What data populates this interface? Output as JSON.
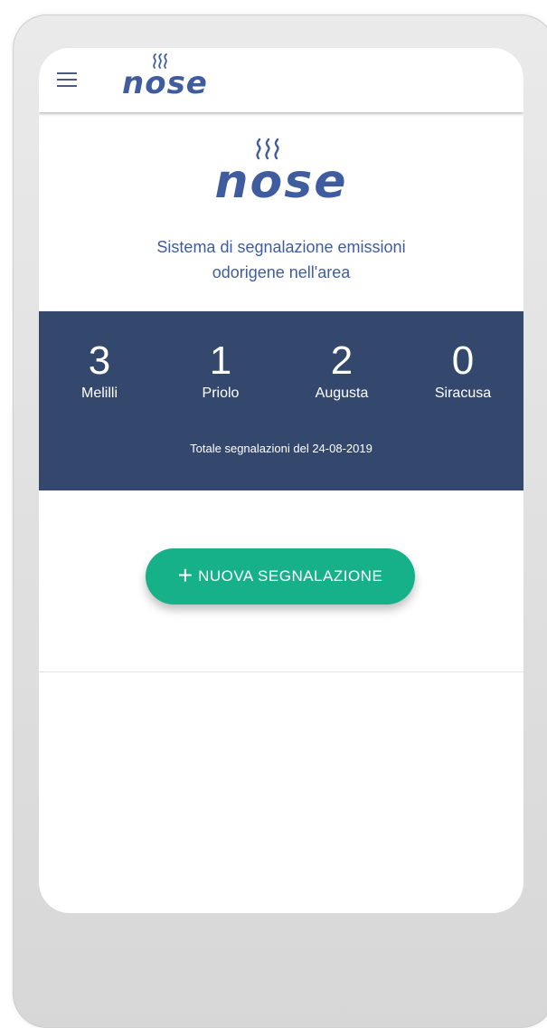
{
  "header": {
    "menu_icon": "hamburger-menu-icon",
    "logo_text": "nose"
  },
  "hero": {
    "logo_text": "nose",
    "subtitle_line1": "Sistema di segnalazione emissioni",
    "subtitle_line2": "odorigene nell'area"
  },
  "stats": {
    "items": [
      {
        "count": "3",
        "label": "Melilli"
      },
      {
        "count": "1",
        "label": "Priolo"
      },
      {
        "count": "2",
        "label": "Augusta"
      },
      {
        "count": "0",
        "label": "Siracusa"
      }
    ],
    "footer": "Totale segnalazioni del 24-08-2019"
  },
  "cta": {
    "icon": "plus-icon",
    "label": "NUOVA SEGNALAZIONE"
  },
  "colors": {
    "brand": "#3f5d9e",
    "stats_bg": "#34486e",
    "cta_bg": "#16b188"
  }
}
